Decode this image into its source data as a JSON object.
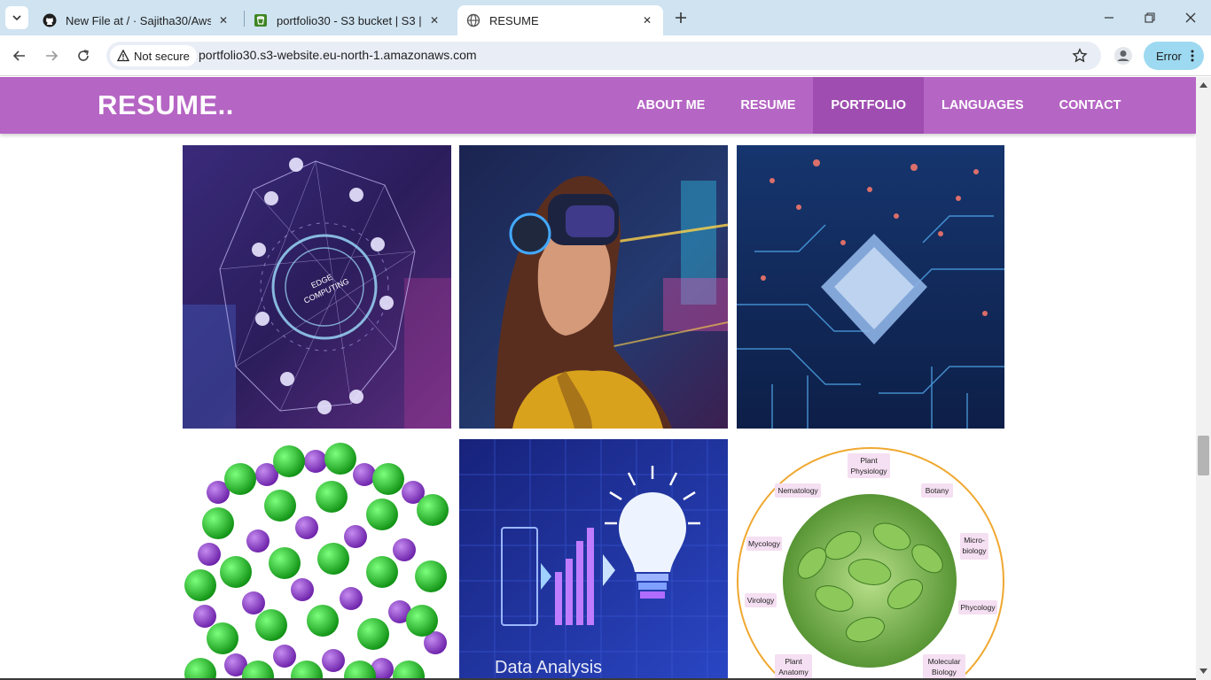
{
  "browser": {
    "tabs": [
      {
        "title": "New File at / · Sajitha30/Aws",
        "favicon": "github-icon"
      },
      {
        "title": "portfolio30 - S3 bucket | S3 | eu",
        "favicon": "aws-s3-icon"
      },
      {
        "title": "RESUME",
        "favicon": "globe-icon",
        "active": true
      }
    ],
    "address_bar": {
      "security_label": "Not secure",
      "url": "portfolio30.s3-website.eu-north-1.amazonaws.com"
    },
    "profile_status": "Error"
  },
  "site": {
    "brand": "RESUME..",
    "nav": [
      {
        "label": "ABOUT ME"
      },
      {
        "label": "RESUME"
      },
      {
        "label": "PORTFOLIO",
        "active": true
      },
      {
        "label": "LANGUAGES"
      },
      {
        "label": "CONTACT"
      }
    ],
    "accent_color": "#b565c4",
    "active_nav_color": "#9f4db0"
  },
  "gallery": {
    "images": [
      {
        "name": "edge-computing-image",
        "center_label": "EDGE COMPUTING"
      },
      {
        "name": "vr-headset-woman-image"
      },
      {
        "name": "circuit-chip-image"
      },
      {
        "name": "molecule-lattice-image"
      },
      {
        "name": "data-analysis-lightbulb-image",
        "text": "Data Analysis"
      },
      {
        "name": "botany-circle-image",
        "branches": [
          "Plant Physiology",
          "Nematology",
          "Botany",
          "Mycology",
          "Micro-biology",
          "Virology",
          "Phycology",
          "Plant Anatomy",
          "Molecular Biology"
        ]
      }
    ]
  }
}
